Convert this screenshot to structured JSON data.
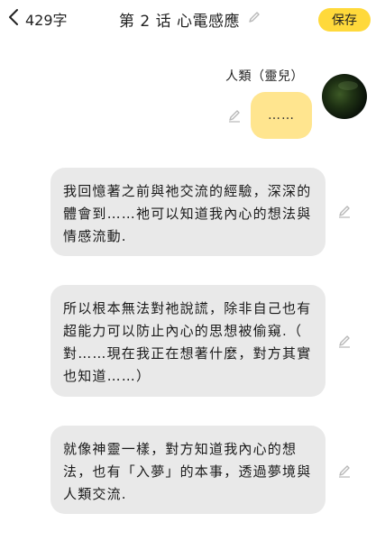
{
  "header": {
    "back_count": "429字",
    "title": "第 2 话  心電感應",
    "save_label": "保存"
  },
  "speaker": {
    "name": "人類（靈兒）",
    "message": "……"
  },
  "messages": [
    {
      "text": "我回憶著之前與祂交流的經驗，深深的體會到……祂可以知道我內心的想法與情感流動."
    },
    {
      "text": "所以根本無法對祂說謊，除非自己也有超能力可以防止內心的思想被偷窺.（ 對……現在我正在想著什麼，對方其實也知道……）"
    },
    {
      "text": "就像神靈一樣，對方知道我內心的想法，也有「入夢」的本事，透過夢境與人類交流."
    }
  ],
  "icons": {
    "back": "chevron-left-icon",
    "title_edit": "pencil-icon",
    "message_edit": "pencil-icon"
  },
  "colors": {
    "save_button": "#ffd93b",
    "user_bubble": "#ffe58f",
    "other_bubble": "#e9e9e9",
    "pencil": "#b8b8b8"
  }
}
